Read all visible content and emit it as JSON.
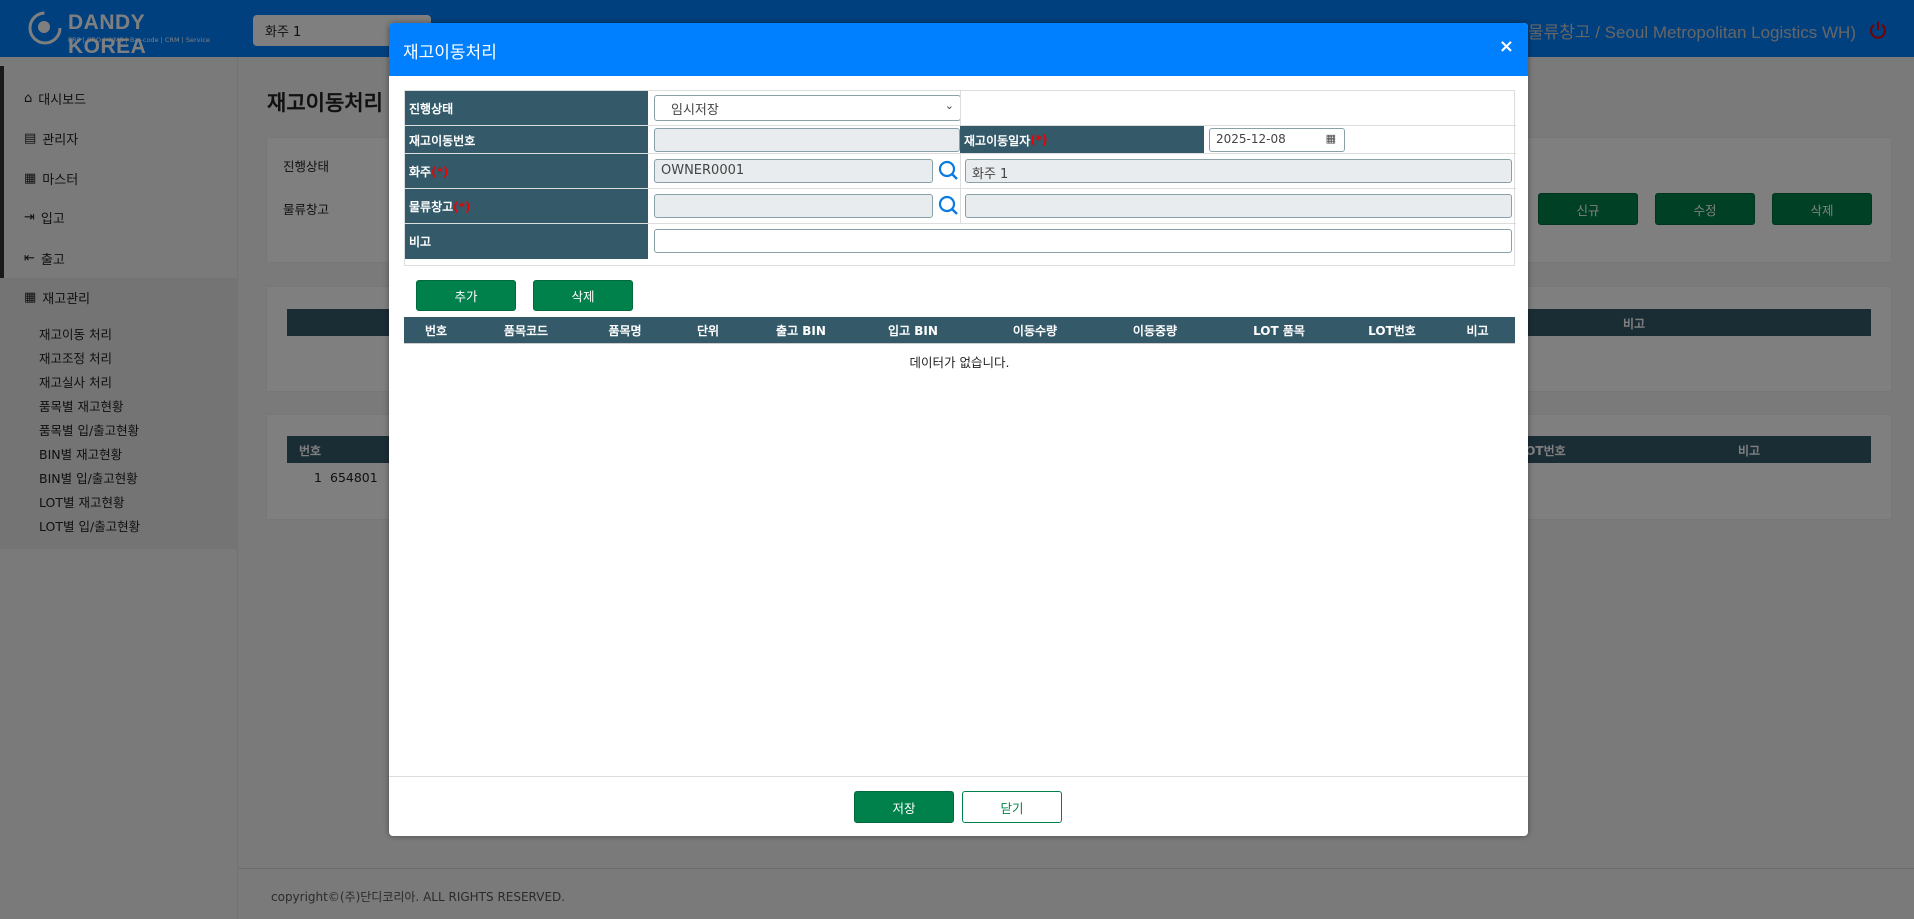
{
  "header": {
    "logo_title": "DANDY KOREA",
    "logo_subtitle": "ERP | CRO | WMS | Bar-code | CRM | Service",
    "owner_select": "화주 1",
    "user_info": "물류창고 / Seoul Metropolitan Logistics WH)"
  },
  "sidebar": {
    "items": [
      {
        "label": "대시보드",
        "icon": "home-icon"
      },
      {
        "label": "관리자",
        "icon": "book-icon"
      },
      {
        "label": "마스터",
        "icon": "document-icon"
      },
      {
        "label": "입고",
        "icon": "sign-in-icon"
      },
      {
        "label": "출고",
        "icon": "sign-out-icon"
      },
      {
        "label": "재고관리",
        "icon": "grid-icon"
      }
    ],
    "sub_items": [
      "재고이동 처리",
      "재고조정 처리",
      "재고실사 처리",
      "품목별 재고현황",
      "품목별 입/출고현황",
      "BIN별 재고현황",
      "BIN별 입/출고현황",
      "LOT별 재고현황",
      "LOT별 입/출고현황"
    ]
  },
  "page": {
    "title": "재고이동처리",
    "filter_labels": [
      "진행상태",
      "물류창고"
    ],
    "buttons": {
      "new": "신규",
      "edit": "수정",
      "delete": "삭제"
    },
    "table1_header_last": "비고",
    "table2": {
      "header_first": "번호",
      "header_lot": "LOT번호",
      "header_last": "비고",
      "row": {
        "no": "1",
        "code": "654801"
      }
    }
  },
  "footer": {
    "copyright": "copyright©(주)단디코리아. ALL RIGHTS RESERVED."
  },
  "modal": {
    "title": "재고이동처리",
    "close": "×",
    "form": {
      "status_label": "진행상태",
      "status_value": "임시저장",
      "move_no_label": "재고이동번호",
      "move_no_value": "",
      "move_date_label": "재고이동일자",
      "move_date_value": "2025-12-08",
      "owner_label": "화주",
      "owner_code": "OWNER0001",
      "owner_name": "화주 1",
      "warehouse_label": "물류창고",
      "warehouse_code": "",
      "warehouse_name": "",
      "remark_label": "비고",
      "remark_value": "",
      "required_mark": "(*)"
    },
    "add_button": "추가",
    "delete_button": "삭제",
    "grid_columns": [
      "번호",
      "품목코드",
      "품목명",
      "단위",
      "출고 BIN",
      "입고 BIN",
      "이동수량",
      "이동중량",
      "LOT 품목",
      "LOT번호",
      "비고"
    ],
    "empty_message": "데이터가 없습니다.",
    "save_button": "저장",
    "cancel_button": "닫기"
  },
  "colors": {
    "primary": "#0080fe",
    "header_cell": "#345a6a",
    "green": "#00804a"
  }
}
